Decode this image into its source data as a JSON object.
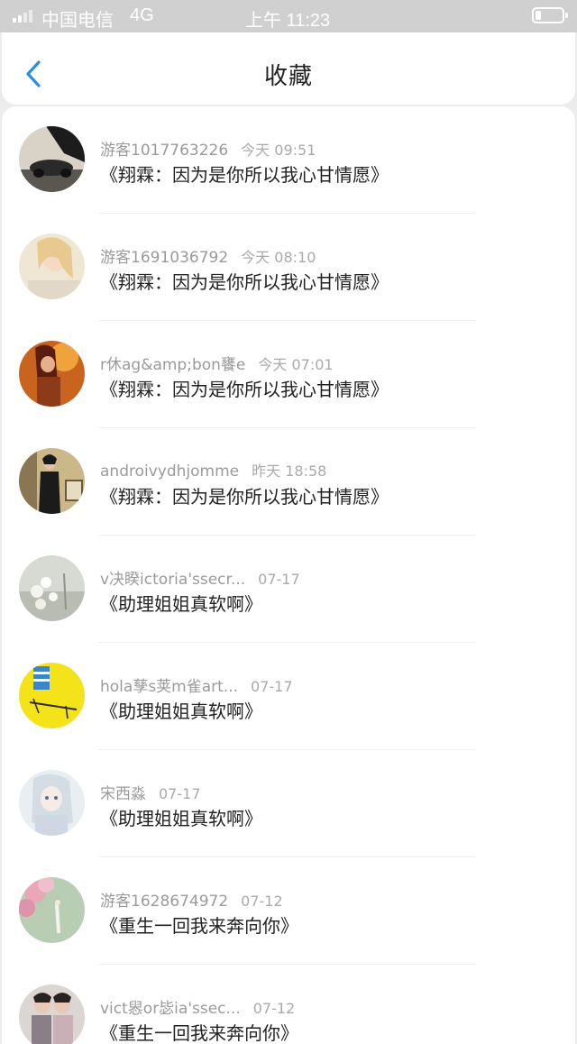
{
  "status_bar": {
    "carrier": "中国电信",
    "network": "4G",
    "time": "上午 11:23",
    "battery_level": 0.2
  },
  "nav": {
    "back_icon": "chevron-left-icon",
    "title": "收藏",
    "accent_color": "#2b8fe0"
  },
  "items": [
    {
      "user": "游客1017763226",
      "time": "今天 09:51",
      "title": "《翔霖：因为是你所以我心甘情愿》"
    },
    {
      "user": "游客1691036792",
      "time": "今天 08:10",
      "title": "《翔霖：因为是你所以我心甘情愿》"
    },
    {
      "user": "r休ag&amp;bon饔e",
      "time": "今天 07:01",
      "title": "《翔霖：因为是你所以我心甘情愿》"
    },
    {
      "user": "androivydhjomme",
      "time": "昨天 18:58",
      "title": "《翔霖：因为是你所以我心甘情愿》"
    },
    {
      "user": "v决睽ictoria'ssecr...",
      "time": "07-17",
      "title": "《助理姐姐真软啊》"
    },
    {
      "user": "hola孳s荚m雀art...",
      "time": "07-17",
      "title": "《助理姐姐真软啊》"
    },
    {
      "user": "宋西淼",
      "time": "07-17",
      "title": "《助理姐姐真软啊》"
    },
    {
      "user": "游客1628674972",
      "time": "07-12",
      "title": "《重生一回我来奔向你》"
    },
    {
      "user": "vict惥or毖ia'ssec...",
      "time": "07-12",
      "title": "《重生一回我来奔向你》"
    }
  ]
}
